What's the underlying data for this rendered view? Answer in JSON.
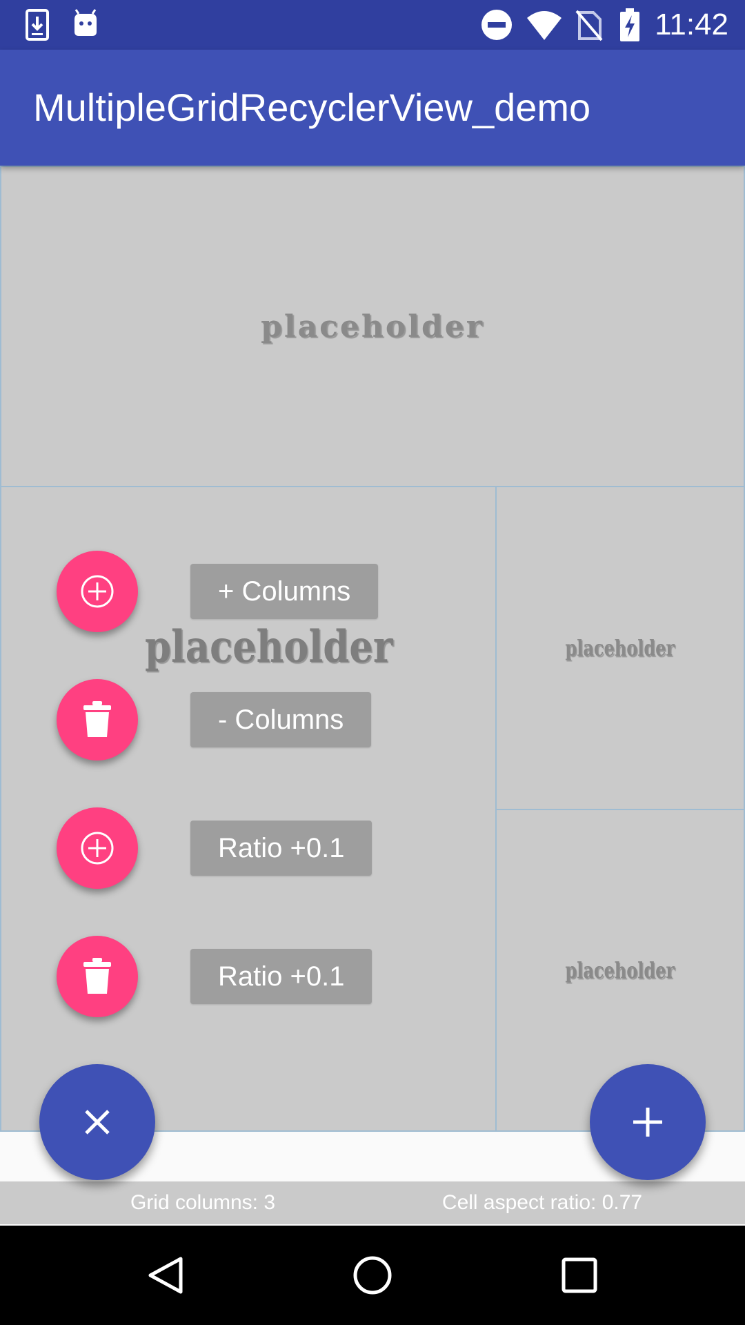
{
  "status_bar": {
    "time": "11:42",
    "left_icons": [
      "download-icon",
      "android-icon"
    ],
    "right_icons": [
      "do-not-disturb-icon",
      "wifi-icon",
      "no-sim-icon",
      "battery-charging-icon"
    ]
  },
  "app_bar": {
    "title": "MultipleGridRecyclerView_demo"
  },
  "grid": {
    "cells": [
      {
        "placeholder": "placeholder"
      },
      {
        "placeholder": "placeholder"
      },
      {
        "placeholder": "placeholder"
      },
      {
        "placeholder": "placeholder"
      }
    ]
  },
  "fab_menu": {
    "items": [
      {
        "icon": "add-circle-icon",
        "label": "+ Columns"
      },
      {
        "icon": "trash-icon",
        "label": "- Columns"
      },
      {
        "icon": "add-circle-icon",
        "label": "Ratio +0.1"
      },
      {
        "icon": "trash-icon",
        "label": "Ratio +0.1"
      }
    ],
    "close_icon": "close-icon",
    "add_icon": "plus-icon"
  },
  "info": {
    "grid_columns": "Grid columns: 3",
    "aspect_ratio": "Cell aspect ratio: 0.77"
  },
  "nav_bar": {
    "icons": [
      "back-icon",
      "home-icon",
      "recents-icon"
    ]
  },
  "colors": {
    "primary": "#3f51b5",
    "primary_dark": "#303f9f",
    "accent": "#ff4081",
    "cell_background": "#cacaca",
    "label_background": "#9e9e9e"
  }
}
